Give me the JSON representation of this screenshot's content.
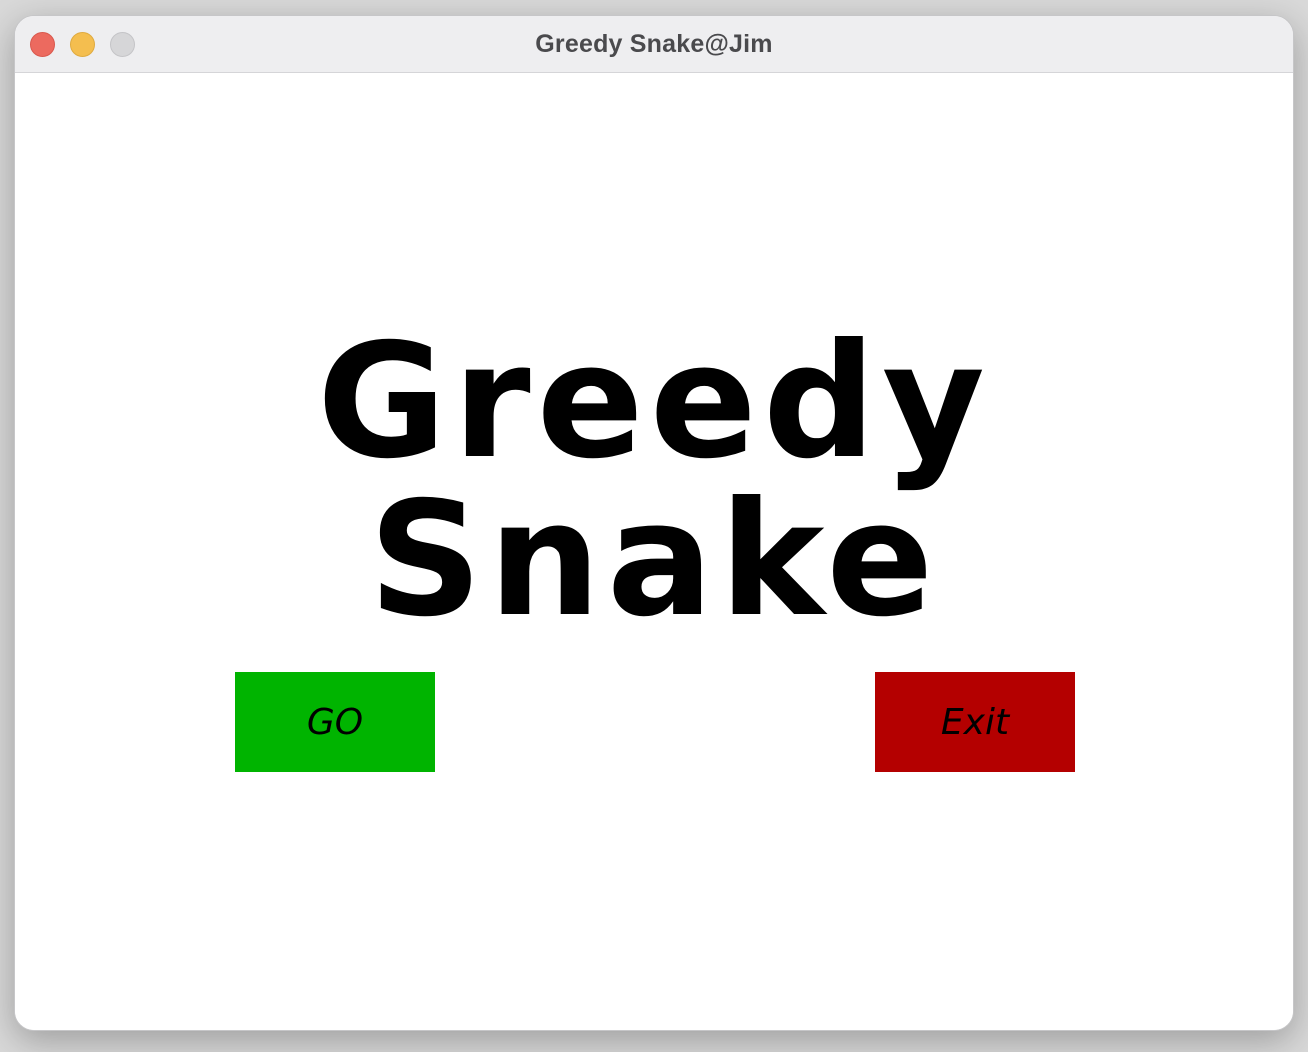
{
  "window": {
    "title": "Greedy Snake@Jim"
  },
  "game": {
    "title": "Greedy Snake",
    "buttons": {
      "go_label": "GO",
      "exit_label": "Exit"
    }
  },
  "colors": {
    "go_button": "#00b400",
    "exit_button": "#b40000",
    "title_text": "#000000"
  },
  "icons": {
    "close": "close-icon",
    "minimize": "minimize-icon",
    "maximize": "maximize-icon"
  }
}
